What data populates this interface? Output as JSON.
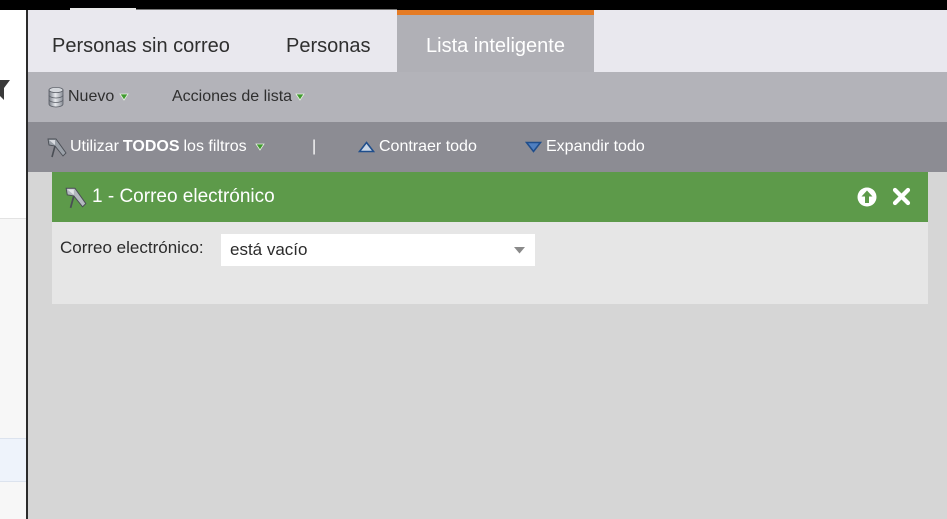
{
  "tabs": [
    {
      "label": "Personas sin correo",
      "active": false
    },
    {
      "label": "Personas",
      "active": false
    },
    {
      "label": "Lista inteligente",
      "active": true
    }
  ],
  "toolbar": {
    "new_label": "Nuevo",
    "list_actions_label": "Acciones de lista"
  },
  "filter_bar": {
    "use_prefix": "Utilizar",
    "use_bold": "TODOS",
    "use_suffix": "los filtros",
    "separator": "|",
    "collapse_label": "Contraer todo",
    "expand_label": "Expandir todo"
  },
  "rule": {
    "title": "1 - Correo electrónico",
    "field_label": "Correo electrónico:",
    "operator_value": "está vacío"
  },
  "colors": {
    "active_tab_accent": "#e57b24",
    "rule_header": "#5d9a4a",
    "dropdown_arrow": "#3f9a2e"
  },
  "icons": {
    "new": "database-icon",
    "filter": "funnel-icon",
    "collapse": "triangle-up-icon",
    "expand": "triangle-down-icon",
    "move_up": "arrow-up-circle-icon",
    "delete": "close-icon"
  }
}
